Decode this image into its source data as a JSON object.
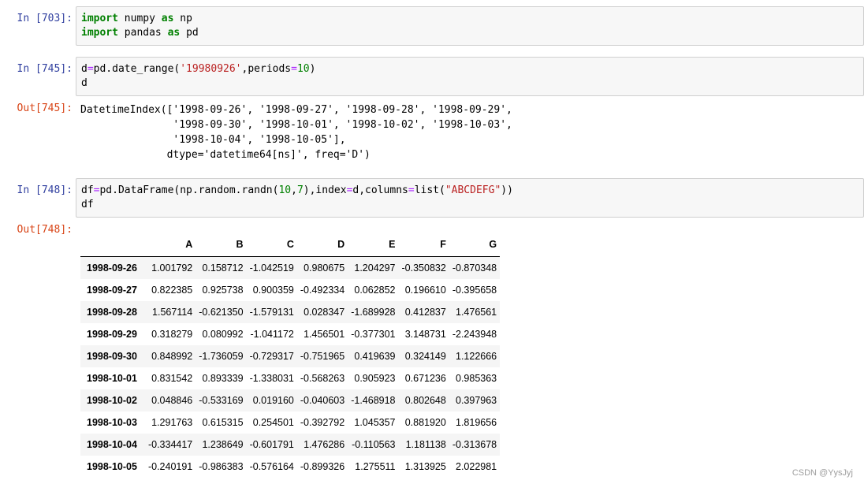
{
  "cells": [
    {
      "prompt": "In  [703]:",
      "code": [
        [
          {
            "t": "import",
            "c": "kw"
          },
          {
            "t": " numpy "
          },
          {
            "t": "as",
            "c": "kw"
          },
          {
            "t": " np"
          }
        ],
        [
          {
            "t": "import",
            "c": "kw"
          },
          {
            "t": " pandas "
          },
          {
            "t": "as",
            "c": "kw"
          },
          {
            "t": " pd"
          }
        ]
      ]
    },
    {
      "prompt": "In  [745]:",
      "code": [
        [
          {
            "t": "d"
          },
          {
            "t": "=",
            "c": "op"
          },
          {
            "t": "pd.date_range("
          },
          {
            "t": "'19980926'",
            "c": "str"
          },
          {
            "t": ",periods"
          },
          {
            "t": "=",
            "c": "op"
          },
          {
            "t": "10",
            "c": "num"
          },
          {
            "t": ")"
          }
        ],
        [
          {
            "t": "d"
          }
        ]
      ]
    },
    {
      "prompt": "In  [748]:",
      "code": [
        [
          {
            "t": "df"
          },
          {
            "t": "=",
            "c": "op"
          },
          {
            "t": "pd.DataFrame(np.random.randn("
          },
          {
            "t": "10",
            "c": "num"
          },
          {
            "t": ","
          },
          {
            "t": "7",
            "c": "num"
          },
          {
            "t": "),index"
          },
          {
            "t": "=",
            "c": "op"
          },
          {
            "t": "d,columns"
          },
          {
            "t": "=",
            "c": "op"
          },
          {
            "t": "list("
          },
          {
            "t": "\"ABCDEFG\"",
            "c": "str"
          },
          {
            "t": "))"
          }
        ],
        [
          {
            "t": "df"
          }
        ]
      ]
    }
  ],
  "outputs": {
    "out745_prompt": "Out[745]:",
    "out745_text": "DatetimeIndex(['1998-09-26', '1998-09-27', '1998-09-28', '1998-09-29',\n               '1998-09-30', '1998-10-01', '1998-10-02', '1998-10-03',\n               '1998-10-04', '1998-10-05'],\n              dtype='datetime64[ns]', freq='D')",
    "out748_prompt": "Out[748]:"
  },
  "dataframe": {
    "columns": [
      "A",
      "B",
      "C",
      "D",
      "E",
      "F",
      "G"
    ],
    "rows": [
      {
        "index": "1998-09-26",
        "values": [
          "1.001792",
          "0.158712",
          "-1.042519",
          "0.980675",
          "1.204297",
          "-0.350832",
          "-0.870348"
        ]
      },
      {
        "index": "1998-09-27",
        "values": [
          "0.822385",
          "0.925738",
          "0.900359",
          "-0.492334",
          "0.062852",
          "0.196610",
          "-0.395658"
        ]
      },
      {
        "index": "1998-09-28",
        "values": [
          "1.567114",
          "-0.621350",
          "-1.579131",
          "0.028347",
          "-1.689928",
          "0.412837",
          "1.476561"
        ]
      },
      {
        "index": "1998-09-29",
        "values": [
          "0.318279",
          "0.080992",
          "-1.041172",
          "1.456501",
          "-0.377301",
          "3.148731",
          "-2.243948"
        ]
      },
      {
        "index": "1998-09-30",
        "values": [
          "0.848992",
          "-1.736059",
          "-0.729317",
          "-0.751965",
          "0.419639",
          "0.324149",
          "1.122666"
        ]
      },
      {
        "index": "1998-10-01",
        "values": [
          "0.831542",
          "0.893339",
          "-1.338031",
          "-0.568263",
          "0.905923",
          "0.671236",
          "0.985363"
        ]
      },
      {
        "index": "1998-10-02",
        "values": [
          "0.048846",
          "-0.533169",
          "0.019160",
          "-0.040603",
          "-1.468918",
          "0.802648",
          "0.397963"
        ]
      },
      {
        "index": "1998-10-03",
        "values": [
          "1.291763",
          "0.615315",
          "0.254501",
          "-0.392792",
          "1.045357",
          "0.881920",
          "1.819656"
        ]
      },
      {
        "index": "1998-10-04",
        "values": [
          "-0.334417",
          "1.238649",
          "-0.601791",
          "1.476286",
          "-0.110563",
          "1.181138",
          "-0.313678"
        ]
      },
      {
        "index": "1998-10-05",
        "values": [
          "-0.240191",
          "-0.986383",
          "-0.576164",
          "-0.899326",
          "1.275511",
          "1.313925",
          "2.022981"
        ]
      }
    ]
  },
  "watermark": "CSDN @YysJyj",
  "colors": {
    "prompt_in": "#303f9f",
    "prompt_out": "#d84315",
    "keyword": "#008000",
    "string": "#ba2121",
    "input_bg": "#f7f7f7"
  }
}
